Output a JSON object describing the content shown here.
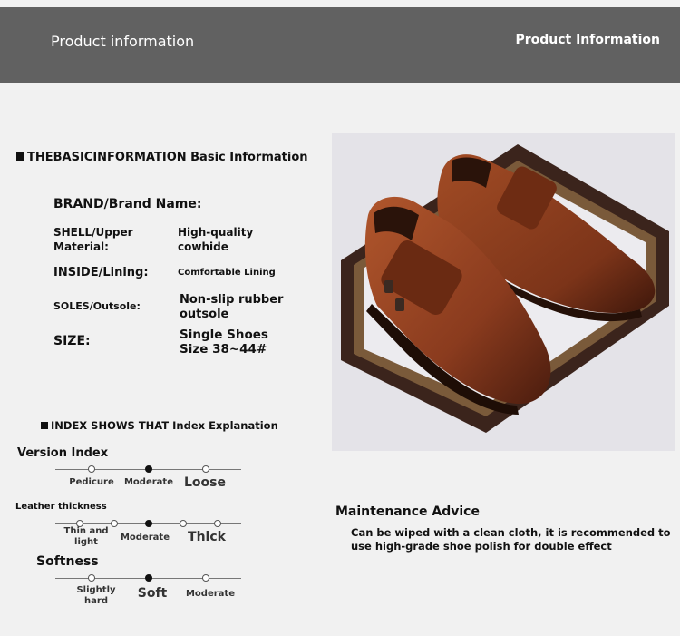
{
  "header": {
    "left_title": "Product information",
    "right_title": "Product Information"
  },
  "basic": {
    "heading": "THEBASICINFORMATION Basic Information",
    "rows": [
      {
        "label": "BRAND/Brand Name:",
        "value": ""
      },
      {
        "label": "SHELL/Upper Material:",
        "value": "High-quality cowhide"
      },
      {
        "label": "INSIDE/Lining:",
        "value": "Comfortable Lining"
      },
      {
        "label": "SOLES/Outsole:",
        "value": "Non-slip rubber outsole"
      },
      {
        "label": "SIZE:",
        "value": "Single Shoes Size 38~44#"
      }
    ]
  },
  "index": {
    "heading": "INDEX SHOWS THAT Index Explanation",
    "scales": [
      {
        "title": "Version Index",
        "options": [
          "Pedicure",
          "Moderate",
          "Loose"
        ],
        "selected": "Moderate"
      },
      {
        "title": "Leather thickness",
        "options": [
          "Thin and light",
          "Moderate",
          "Thick"
        ],
        "selected": "Moderate"
      },
      {
        "title": "Softness",
        "options": [
          "Slightly hard",
          "Soft",
          "Moderate"
        ],
        "selected": "Soft"
      }
    ]
  },
  "maintenance": {
    "title": "Maintenance Advice",
    "text": "Can be wiped with a clean cloth, it is recommended to use high-grade shoe polish for double effect"
  },
  "colors": {
    "header_bg": "#616161",
    "page_bg": "#f1f1f1",
    "leather": "#8a3b1e",
    "frame": "#3b241c"
  }
}
